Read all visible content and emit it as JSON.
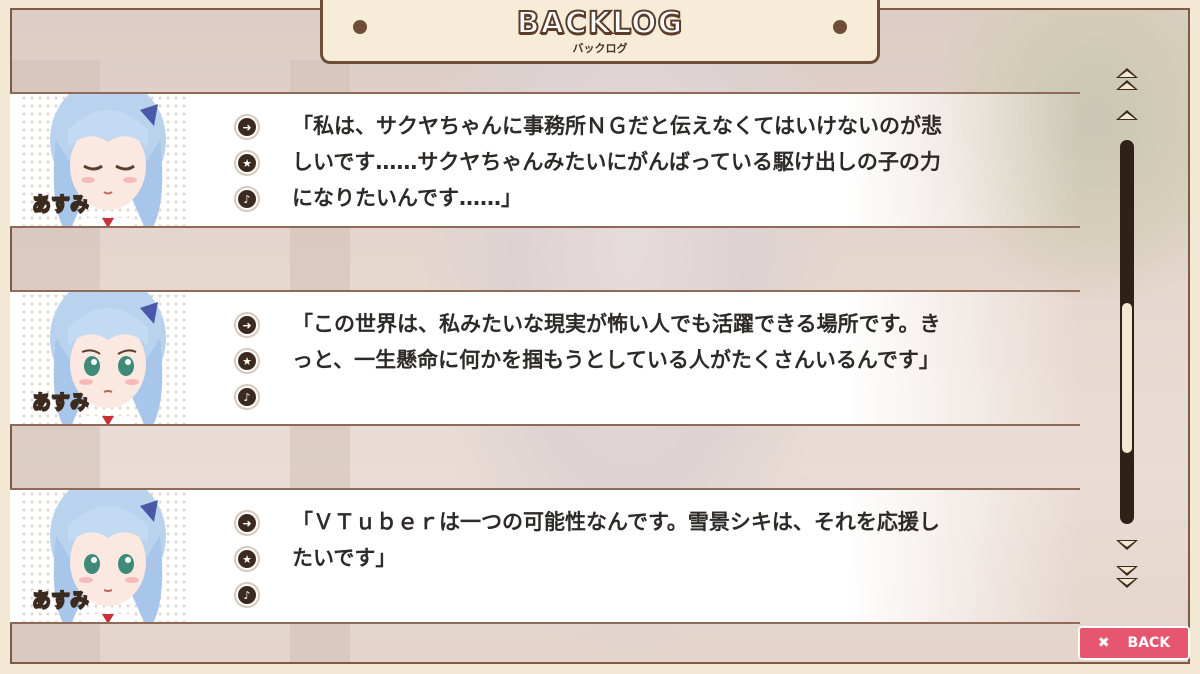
{
  "screen": {
    "title": "BACKLOG",
    "subtitle": "バックログ"
  },
  "entries": [
    {
      "speaker": "あすみ",
      "expression": "eyes-closed",
      "text": "「私は、サクヤちゃんに事務所ＮＧだと伝えなくてはいけないのが悲しいです……サクヤちゃんみたいにがんばっている駆け出しの子の力になりたいんです……」"
    },
    {
      "speaker": "あすみ",
      "expression": "sad",
      "text": "「この世界は、私みたいな現実が怖い人でも活躍できる場所です。きっと、一生懸命に何かを掴もうとしている人がたくさんいるんです」"
    },
    {
      "speaker": "あすみ",
      "expression": "neutral",
      "text": "「ＶＴｕｂｅｒは一つの可能性なんです。雪景シキは、それを応援したいです」"
    }
  ],
  "entry_controls": {
    "jump_icon": "arrow-jump-icon",
    "favorite_icon": "star-icon",
    "voice_icon": "speaker-icon"
  },
  "scroll": {
    "position_fraction": 0.7
  },
  "back_button": {
    "label": "BACK",
    "icon": "close-x-icon"
  },
  "colors": {
    "frame": "#f3e8d4",
    "frame_border": "#7d5b45",
    "back_button": "#e6576f",
    "hair": "#b9d3ef",
    "ribbon": "#4a58a8"
  }
}
